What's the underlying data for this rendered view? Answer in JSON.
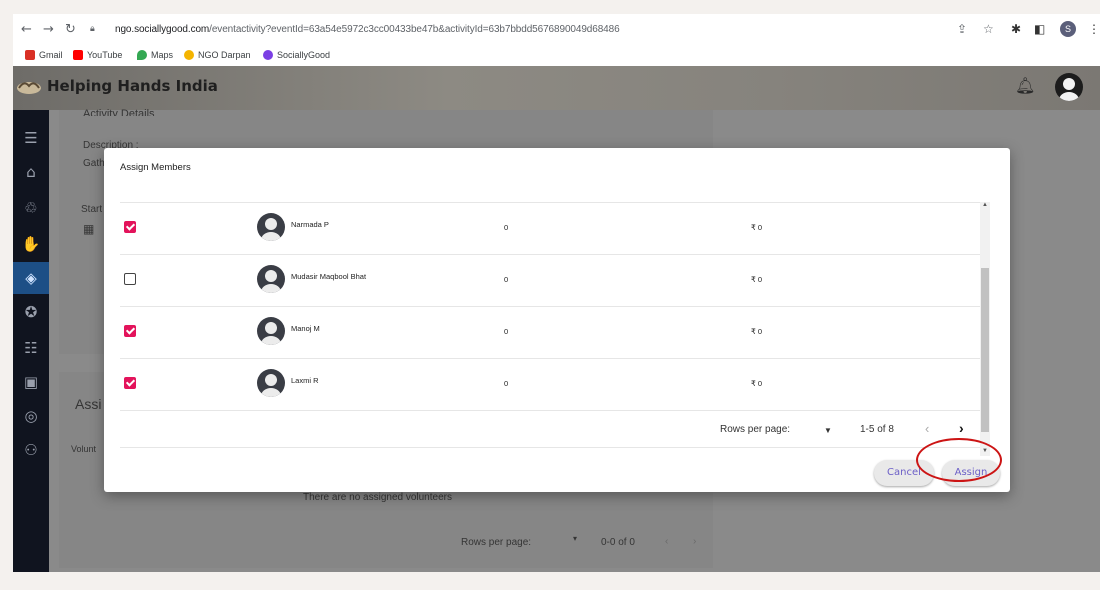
{
  "browser": {
    "url_host": "ngo.sociallygood.com",
    "url_rest": "/eventactivity?eventId=63a54e5972c3cc00433be47b&activityId=63b7bbdd5676890049d68486",
    "profile_initial": "S",
    "bookmarks": [
      {
        "label": "Gmail",
        "color": "#d93025"
      },
      {
        "label": "YouTube",
        "color": "#ff0000"
      },
      {
        "label": "Maps",
        "color": "#34a853"
      },
      {
        "label": "NGO Darpan",
        "color": "#f4b400"
      },
      {
        "label": "SociallyGood",
        "color": "#7b3fe4"
      }
    ]
  },
  "app": {
    "title": "Helping Hands India"
  },
  "background": {
    "section_title": "Activity Details",
    "description_label": "Description :",
    "description_value": "Gath",
    "start_label": "Start",
    "assigned_title": "Assi",
    "volunteer_col": "Volunt",
    "empty_text": "There are no assigned volunteers",
    "rows_per_page": "Rows per page:",
    "range": "0-0 of 0"
  },
  "modal": {
    "title": "Assign Members",
    "members": [
      {
        "name": "Narmada P",
        "count": "0",
        "amount": "₹ 0",
        "checked": true
      },
      {
        "name": "Mudasir Maqbool Bhat",
        "count": "0",
        "amount": "₹ 0",
        "checked": false
      },
      {
        "name": "Manoj M",
        "count": "0",
        "amount": "₹ 0",
        "checked": true
      },
      {
        "name": "Laxmi R",
        "count": "0",
        "amount": "₹ 0",
        "checked": true
      }
    ],
    "pager": {
      "rows_per_page_label": "Rows per page:",
      "range": "1-5 of 8"
    },
    "cancel_label": "Cancel",
    "assign_label": "Assign"
  },
  "colors": {
    "checkbox_checked": "#e3135b",
    "button_text": "#6c5fc7",
    "sidebar": "#10141f",
    "highlight": "#cc1414"
  }
}
